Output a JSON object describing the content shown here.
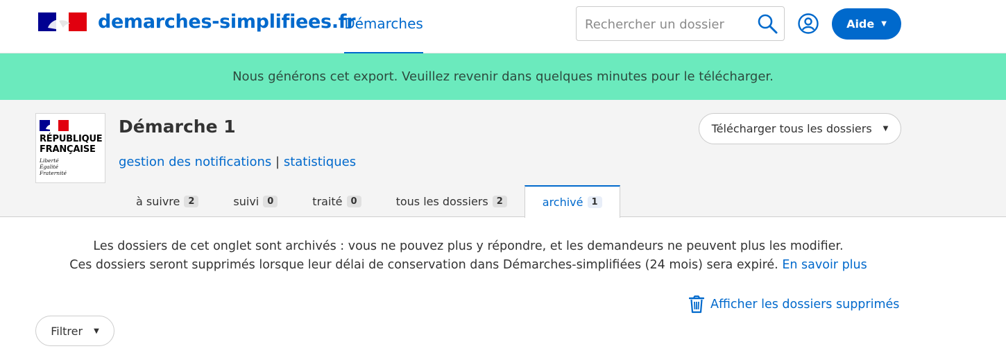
{
  "header": {
    "brand": "demarches-simplifiees.fr",
    "nav_demarches": "Démarches",
    "search_placeholder": "Rechercher un dossier",
    "aide_label": "Aide"
  },
  "flash": {
    "message": "Nous générons cet export. Veuillez revenir dans quelques minutes pour le télécharger."
  },
  "procedure": {
    "logo_line1": "RÉPUBLIQUE",
    "logo_line2": "FRANÇAISE",
    "motto_1": "Liberté",
    "motto_2": "Égalité",
    "motto_3": "Fraternité",
    "title": "Démarche 1",
    "link_notifications": "gestion des notifications",
    "separator": "|",
    "link_stats": "statistiques",
    "download_label": "Télécharger tous les dossiers"
  },
  "tabs": [
    {
      "label": "à suivre",
      "count": "2"
    },
    {
      "label": "suivi",
      "count": "0"
    },
    {
      "label": "traité",
      "count": "0"
    },
    {
      "label": "tous les dossiers",
      "count": "2"
    },
    {
      "label": "archivé",
      "count": "1"
    }
  ],
  "notice": {
    "line1": "Les dossiers de cet onglet sont archivés : vous ne pouvez plus y répondre, et les demandeurs ne peuvent plus les modifier.",
    "line2": "Ces dossiers seront supprimés lorsque leur délai de conservation dans Démarches-simplifiées (24 mois) sera expiré.",
    "learn_more": "En savoir plus"
  },
  "deleted_link": "Afficher les dossiers supprimés",
  "filter_label": "Filtrer",
  "icons": {
    "search": "search-icon",
    "user": "user-circle-icon",
    "trash": "trash-icon",
    "caret": "caret-down-icon"
  },
  "colors": {
    "primary": "#0069cc",
    "flash_bg": "#6beabd",
    "header_band": "#f4f4f4"
  }
}
